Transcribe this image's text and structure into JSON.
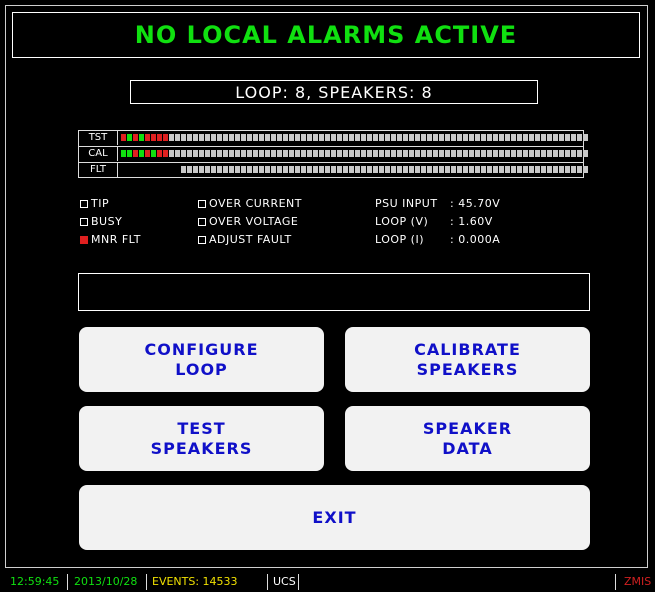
{
  "banner": {
    "title": "NO LOCAL ALARMS ACTIVE"
  },
  "loop_info": "LOOP: 8, SPEAKERS: 8",
  "led_panel": {
    "rows": [
      {
        "label": "TST",
        "states": [
          "red",
          "green",
          "red",
          "green",
          "red",
          "red",
          "red",
          "red",
          "off",
          "off",
          "off",
          "off",
          "off",
          "off",
          "off",
          "off",
          "off",
          "off",
          "off",
          "off",
          "off",
          "off",
          "off",
          "off",
          "off",
          "off",
          "off",
          "off",
          "off",
          "off",
          "off",
          "off",
          "off",
          "off",
          "off",
          "off",
          "off",
          "off",
          "off",
          "off",
          "off",
          "off",
          "off",
          "off",
          "off",
          "off",
          "off",
          "off",
          "off",
          "off",
          "off",
          "off",
          "off",
          "off",
          "off",
          "off",
          "off",
          "off",
          "off",
          "off",
          "off",
          "off",
          "off",
          "off",
          "off",
          "off",
          "off",
          "off",
          "off",
          "off",
          "off",
          "off",
          "off",
          "off",
          "off",
          "off",
          "off",
          "off"
        ]
      },
      {
        "label": "CAL",
        "states": [
          "green",
          "green",
          "red",
          "green",
          "red",
          "green",
          "red",
          "red",
          "off",
          "off",
          "off",
          "off",
          "off",
          "off",
          "off",
          "off",
          "off",
          "off",
          "off",
          "off",
          "off",
          "off",
          "off",
          "off",
          "off",
          "off",
          "off",
          "off",
          "off",
          "off",
          "off",
          "off",
          "off",
          "off",
          "off",
          "off",
          "off",
          "off",
          "off",
          "off",
          "off",
          "off",
          "off",
          "off",
          "off",
          "off",
          "off",
          "off",
          "off",
          "off",
          "off",
          "off",
          "off",
          "off",
          "off",
          "off",
          "off",
          "off",
          "off",
          "off",
          "off",
          "off",
          "off",
          "off",
          "off",
          "off",
          "off",
          "off",
          "off",
          "off",
          "off",
          "off",
          "off",
          "off",
          "off",
          "off",
          "off",
          "off"
        ]
      },
      {
        "label": "FLT",
        "states": [
          "none",
          "none",
          "none",
          "none",
          "none",
          "none",
          "none",
          "none",
          "none",
          "none",
          "off",
          "off",
          "off",
          "off",
          "off",
          "off",
          "off",
          "off",
          "off",
          "off",
          "off",
          "off",
          "off",
          "off",
          "off",
          "off",
          "off",
          "off",
          "off",
          "off",
          "off",
          "off",
          "off",
          "off",
          "off",
          "off",
          "off",
          "off",
          "off",
          "off",
          "off",
          "off",
          "off",
          "off",
          "off",
          "off",
          "off",
          "off",
          "off",
          "off",
          "off",
          "off",
          "off",
          "off",
          "off",
          "off",
          "off",
          "off",
          "off",
          "off",
          "off",
          "off",
          "off",
          "off",
          "off",
          "off",
          "off",
          "off",
          "off",
          "off",
          "off",
          "off",
          "off",
          "off",
          "off",
          "off",
          "off",
          "off"
        ]
      }
    ]
  },
  "status_flags": {
    "tip": {
      "label": "TIP",
      "active": false
    },
    "busy": {
      "label": "BUSY",
      "active": false
    },
    "mnr_flt": {
      "label": "MNR FLT",
      "active": true
    },
    "over_current": {
      "label": "OVER CURRENT",
      "active": false
    },
    "over_voltage": {
      "label": "OVER VOLTAGE",
      "active": false
    },
    "adjust_fault": {
      "label": "ADJUST FAULT",
      "active": false
    }
  },
  "readings": {
    "psu_label": "PSU INPUT",
    "psu_value": ": 45.70V",
    "loopv_label": "LOOP (V)",
    "loopv_value": ": 1.60V",
    "loopi_label": "LOOP (I)",
    "loopi_value": ": 0.000A"
  },
  "message": "",
  "buttons": {
    "configure_loop": "CONFIGURE\nLOOP",
    "calibrate_speakers": "CALIBRATE\nSPEAKERS",
    "test_speakers": "TEST\nSPEAKERS",
    "speaker_data": "SPEAKER\nDATA",
    "exit": "EXIT"
  },
  "statusbar": {
    "time": "12:59:45",
    "date": "2013/10/28",
    "events": "EVENTS: 14533",
    "mode": "UCS",
    "right": "ZMIS"
  },
  "colors": {
    "led_green": "#10e010",
    "led_red": "#e02020",
    "led_off": "#c8c8c8",
    "button_text": "#1010c8",
    "banner_text": "#10e010"
  }
}
